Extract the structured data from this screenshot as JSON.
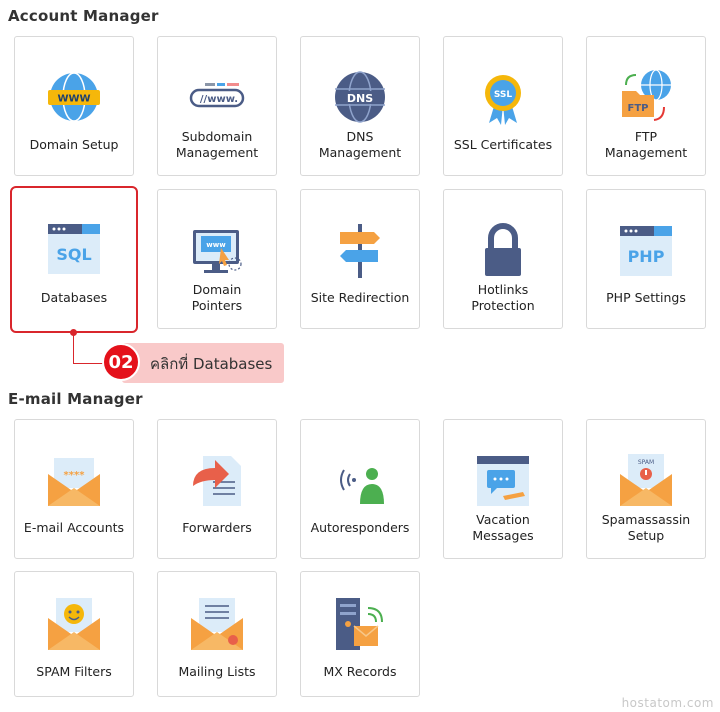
{
  "account_section": {
    "title": "Account Manager",
    "tiles": [
      {
        "label": "Domain Setup",
        "icon": "www-globe-icon"
      },
      {
        "label": "Subdomain\nManagement",
        "icon": "subdomain-www-icon"
      },
      {
        "label": "DNS\nManagement",
        "icon": "dns-globe-icon"
      },
      {
        "label": "SSL Certificates",
        "icon": "ssl-badge-icon"
      },
      {
        "label": "FTP\nManagement",
        "icon": "ftp-folder-icon"
      },
      {
        "label": "Databases",
        "icon": "sql-database-icon"
      },
      {
        "label": "Domain\nPointers",
        "icon": "domain-pointer-icon"
      },
      {
        "label": "Site Redirection",
        "icon": "signpost-icon"
      },
      {
        "label": "Hotlinks\nProtection",
        "icon": "padlock-icon"
      },
      {
        "label": "PHP Settings",
        "icon": "php-window-icon"
      }
    ]
  },
  "callout": {
    "step": "02",
    "text": "คลิกที่ Databases"
  },
  "email_section": {
    "title": "E-mail Manager",
    "tiles": [
      {
        "label": "E-mail Accounts",
        "icon": "email-password-icon"
      },
      {
        "label": "Forwarders",
        "icon": "forward-document-icon"
      },
      {
        "label": "Autoresponders",
        "icon": "autoresponder-person-icon"
      },
      {
        "label": "Vacation\nMessages",
        "icon": "vacation-chat-icon"
      },
      {
        "label": "Spamassassin\nSetup",
        "icon": "spam-envelope-icon"
      },
      {
        "label": "SPAM Filters",
        "icon": "smiley-envelope-icon"
      },
      {
        "label": "Mailing Lists",
        "icon": "mailing-list-envelope-icon"
      },
      {
        "label": "MX Records",
        "icon": "mx-server-icon"
      }
    ]
  },
  "watermark": "hostatom.com",
  "colors": {
    "accent_red": "#d9262c",
    "badge_red": "#e4111b",
    "callout_bg": "#f9c9c9"
  }
}
